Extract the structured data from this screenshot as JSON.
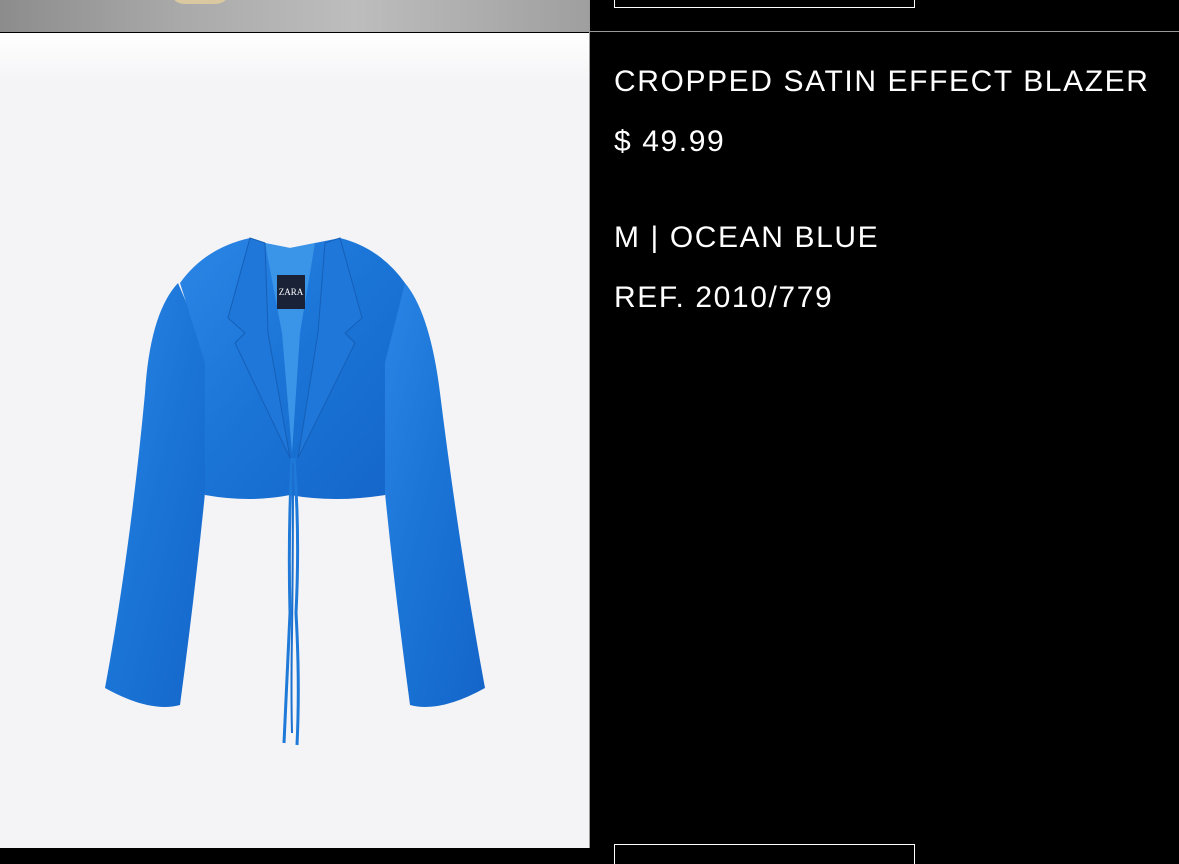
{
  "product": {
    "name": "CROPPED SATIN EFFECT BLAZER",
    "price": "$ 49.99",
    "variant": "M | OCEAN BLUE",
    "reference": "REF. 2010/779",
    "color_hex": "#1e79d8"
  },
  "image": {
    "label_brand": "ZARA"
  },
  "colors": {
    "background": "#000000",
    "divider": "#9a9a9a",
    "image_bg": "#f4f4f6"
  }
}
